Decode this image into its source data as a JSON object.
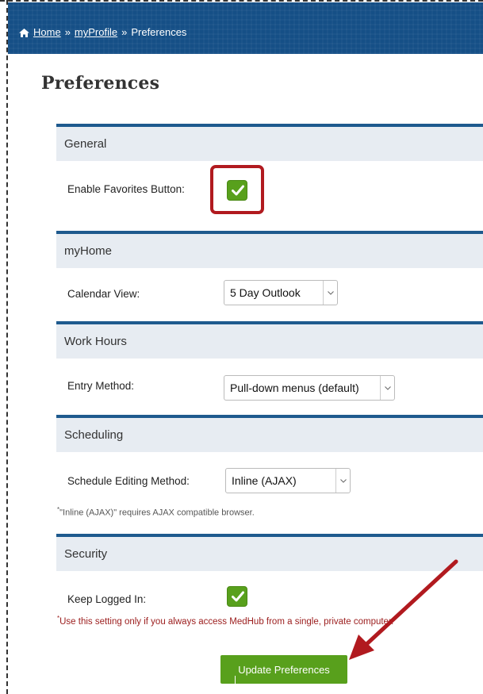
{
  "breadcrumb": {
    "home": "Home",
    "sep1": "»",
    "profile": "myProfile",
    "sep2": "»",
    "current": "Preferences"
  },
  "page": {
    "title": "Preferences"
  },
  "sections": {
    "general": {
      "title": "General",
      "favorites_label": "Enable Favorites Button:",
      "favorites_checked": true
    },
    "myhome": {
      "title": "myHome",
      "calendar_label": "Calendar View:",
      "calendar_value": "5 Day Outlook"
    },
    "workhours": {
      "title": "Work Hours",
      "entry_label": "Entry Method:",
      "entry_value": "Pull-down menus (default)"
    },
    "scheduling": {
      "title": "Scheduling",
      "edit_label": "Schedule Editing Method:",
      "edit_value": "Inline (AJAX)",
      "note_star": "*",
      "note": "\"Inline (AJAX)\" requires AJAX compatible browser."
    },
    "security": {
      "title": "Security",
      "keep_label": "Keep Logged In:",
      "keep_checked": true,
      "warn_star": "*",
      "warning": "Use this setting only if you always access MedHub from a single, private computer."
    }
  },
  "actions": {
    "update_label": "Update Preferences"
  },
  "colors": {
    "header_blue": "#154f86",
    "section_border": "#1e5a8e",
    "section_bg": "#e7ecf2",
    "check_green": "#58a01c",
    "annotation_red": "#b11a1f"
  }
}
